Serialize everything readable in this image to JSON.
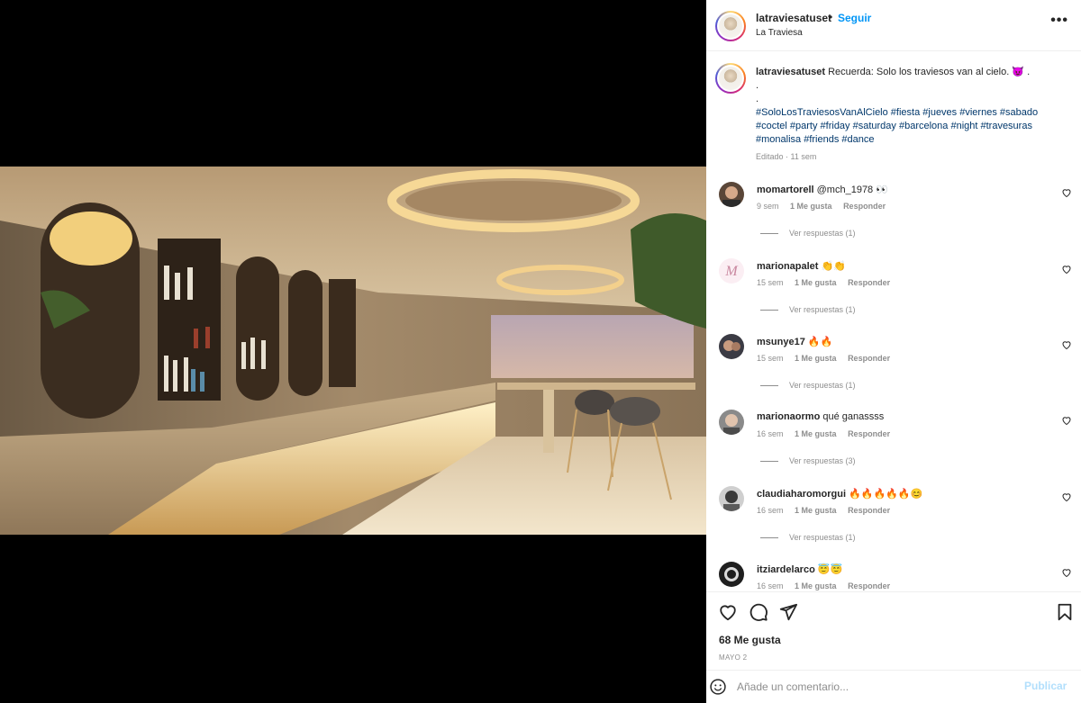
{
  "post": {
    "username": "latraviesatuset",
    "separator": "•",
    "follow_label": "Seguir",
    "location": "La Traviesa",
    "more_label": "•••"
  },
  "caption": {
    "username": "latraviesatuset",
    "text": "Recuerda: Solo los traviesos van al cielo. 😈 .",
    "dot1": ".",
    "dot2": ".",
    "hashtags_line1": "#SoloLosTraviesosVanAlCielo #fiesta #jueves #viernes #sabado",
    "hashtags_line2": "#coctel #party #friday #saturday #barcelona #night #travesuras",
    "hashtags_line3": "#monalisa #friends #dance",
    "meta": "Editado · 11 sem"
  },
  "comments": [
    {
      "username": "momartorell",
      "text": "@mch_1978 👀",
      "time": "9 sem",
      "likes": "1 Me gusta",
      "reply": "Responder",
      "replies": "Ver respuestas (1)",
      "avatar_color": "#5a4638"
    },
    {
      "username": "marionapalet",
      "text": "👏👏",
      "time": "15 sem",
      "likes": "1 Me gusta",
      "reply": "Responder",
      "replies": "Ver respuestas (1)",
      "avatar_color": "#f4dbe6"
    },
    {
      "username": "msunye17",
      "text": "🔥🔥",
      "time": "15 sem",
      "likes": "1 Me gusta",
      "reply": "Responder",
      "replies": "Ver respuestas (1)",
      "avatar_color": "#3b3b44"
    },
    {
      "username": "marionaormo",
      "text": "qué ganassss",
      "time": "16 sem",
      "likes": "1 Me gusta",
      "reply": "Responder",
      "replies": "Ver respuestas (3)",
      "avatar_color": "#6c6c6c"
    },
    {
      "username": "claudiaharomorgui",
      "text": "🔥🔥🔥🔥🔥😊",
      "time": "16 sem",
      "likes": "1 Me gusta",
      "reply": "Responder",
      "replies": "Ver respuestas (1)",
      "avatar_color": "#2e2e2e"
    },
    {
      "username": "itziardelarco",
      "text": "😇😇",
      "time": "16 sem",
      "likes": "1 Me gusta",
      "reply": "Responder",
      "replies": "",
      "avatar_color": "#1f1f1f"
    }
  ],
  "actions": {
    "likes": "68 Me gusta",
    "date": "MAYO 2"
  },
  "add_comment": {
    "placeholder": "Añade un comentario...",
    "publish_label": "Publicar"
  }
}
